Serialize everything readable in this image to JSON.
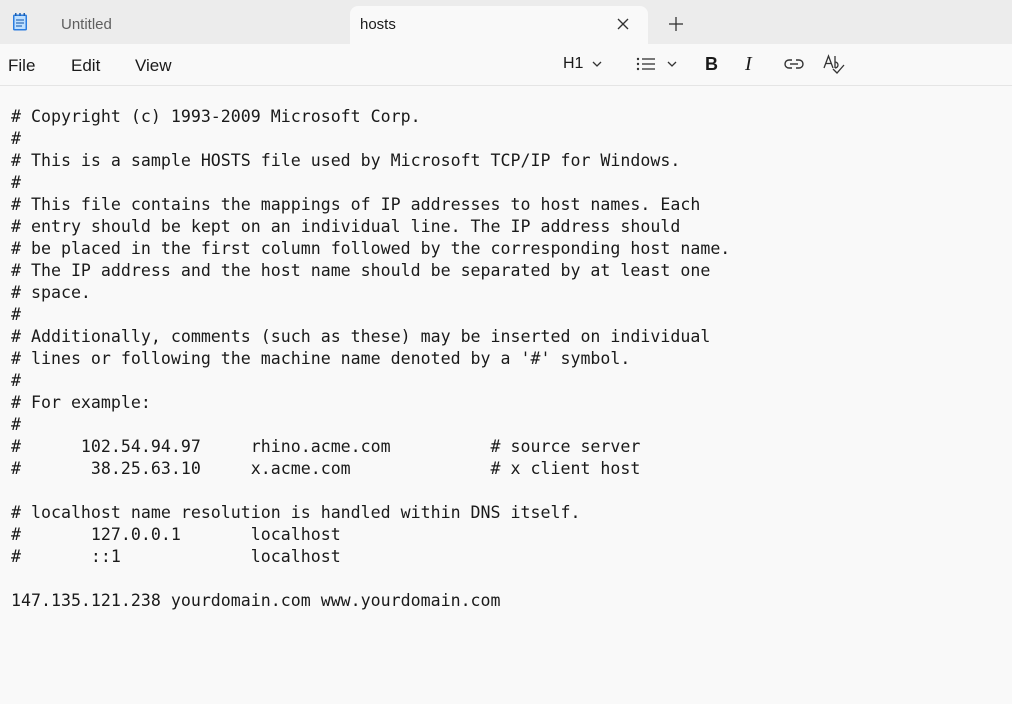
{
  "tabs": [
    {
      "label": "Untitled",
      "active": false
    },
    {
      "label": "hosts",
      "active": true
    }
  ],
  "menu": {
    "file": "File",
    "edit": "Edit",
    "view": "View"
  },
  "toolbar": {
    "heading_label": "H1",
    "bold_label": "B",
    "italic_label": "I",
    "icons": [
      "list-icon",
      "link-icon",
      "spell-check-icon"
    ]
  },
  "editor": {
    "content": "# Copyright (c) 1993-2009 Microsoft Corp.\n#\n# This is a sample HOSTS file used by Microsoft TCP/IP for Windows.\n#\n# This file contains the mappings of IP addresses to host names. Each\n# entry should be kept on an individual line. The IP address should\n# be placed in the first column followed by the corresponding host name.\n# The IP address and the host name should be separated by at least one\n# space.\n#\n# Additionally, comments (such as these) may be inserted on individual\n# lines or following the machine name denoted by a '#' symbol.\n#\n# For example:\n#\n#      102.54.94.97     rhino.acme.com          # source server\n#       38.25.63.10     x.acme.com              # x client host\n\n# localhost name resolution is handled within DNS itself.\n#       127.0.0.1       localhost\n#       ::1             localhost\n\n147.135.121.238 yourdomain.com www.yourdomain.com"
  }
}
